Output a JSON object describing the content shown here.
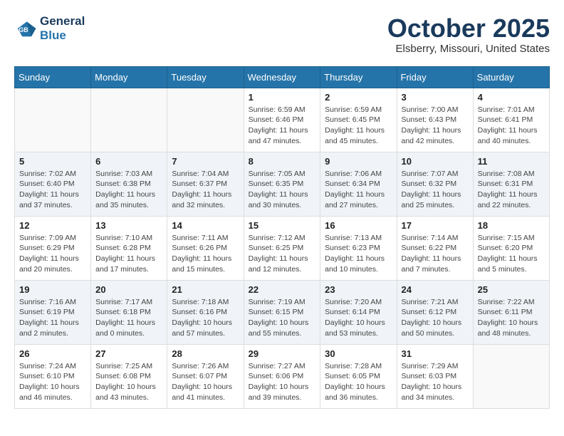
{
  "header": {
    "logo_line1": "General",
    "logo_line2": "Blue",
    "month_title": "October 2025",
    "location": "Elsberry, Missouri, United States"
  },
  "weekdays": [
    "Sunday",
    "Monday",
    "Tuesday",
    "Wednesday",
    "Thursday",
    "Friday",
    "Saturday"
  ],
  "weeks": [
    [
      {
        "day": "",
        "info": ""
      },
      {
        "day": "",
        "info": ""
      },
      {
        "day": "",
        "info": ""
      },
      {
        "day": "1",
        "info": "Sunrise: 6:59 AM\nSunset: 6:46 PM\nDaylight: 11 hours\nand 47 minutes."
      },
      {
        "day": "2",
        "info": "Sunrise: 6:59 AM\nSunset: 6:45 PM\nDaylight: 11 hours\nand 45 minutes."
      },
      {
        "day": "3",
        "info": "Sunrise: 7:00 AM\nSunset: 6:43 PM\nDaylight: 11 hours\nand 42 minutes."
      },
      {
        "day": "4",
        "info": "Sunrise: 7:01 AM\nSunset: 6:41 PM\nDaylight: 11 hours\nand 40 minutes."
      }
    ],
    [
      {
        "day": "5",
        "info": "Sunrise: 7:02 AM\nSunset: 6:40 PM\nDaylight: 11 hours\nand 37 minutes."
      },
      {
        "day": "6",
        "info": "Sunrise: 7:03 AM\nSunset: 6:38 PM\nDaylight: 11 hours\nand 35 minutes."
      },
      {
        "day": "7",
        "info": "Sunrise: 7:04 AM\nSunset: 6:37 PM\nDaylight: 11 hours\nand 32 minutes."
      },
      {
        "day": "8",
        "info": "Sunrise: 7:05 AM\nSunset: 6:35 PM\nDaylight: 11 hours\nand 30 minutes."
      },
      {
        "day": "9",
        "info": "Sunrise: 7:06 AM\nSunset: 6:34 PM\nDaylight: 11 hours\nand 27 minutes."
      },
      {
        "day": "10",
        "info": "Sunrise: 7:07 AM\nSunset: 6:32 PM\nDaylight: 11 hours\nand 25 minutes."
      },
      {
        "day": "11",
        "info": "Sunrise: 7:08 AM\nSunset: 6:31 PM\nDaylight: 11 hours\nand 22 minutes."
      }
    ],
    [
      {
        "day": "12",
        "info": "Sunrise: 7:09 AM\nSunset: 6:29 PM\nDaylight: 11 hours\nand 20 minutes."
      },
      {
        "day": "13",
        "info": "Sunrise: 7:10 AM\nSunset: 6:28 PM\nDaylight: 11 hours\nand 17 minutes."
      },
      {
        "day": "14",
        "info": "Sunrise: 7:11 AM\nSunset: 6:26 PM\nDaylight: 11 hours\nand 15 minutes."
      },
      {
        "day": "15",
        "info": "Sunrise: 7:12 AM\nSunset: 6:25 PM\nDaylight: 11 hours\nand 12 minutes."
      },
      {
        "day": "16",
        "info": "Sunrise: 7:13 AM\nSunset: 6:23 PM\nDaylight: 11 hours\nand 10 minutes."
      },
      {
        "day": "17",
        "info": "Sunrise: 7:14 AM\nSunset: 6:22 PM\nDaylight: 11 hours\nand 7 minutes."
      },
      {
        "day": "18",
        "info": "Sunrise: 7:15 AM\nSunset: 6:20 PM\nDaylight: 11 hours\nand 5 minutes."
      }
    ],
    [
      {
        "day": "19",
        "info": "Sunrise: 7:16 AM\nSunset: 6:19 PM\nDaylight: 11 hours\nand 2 minutes."
      },
      {
        "day": "20",
        "info": "Sunrise: 7:17 AM\nSunset: 6:18 PM\nDaylight: 11 hours\nand 0 minutes."
      },
      {
        "day": "21",
        "info": "Sunrise: 7:18 AM\nSunset: 6:16 PM\nDaylight: 10 hours\nand 57 minutes."
      },
      {
        "day": "22",
        "info": "Sunrise: 7:19 AM\nSunset: 6:15 PM\nDaylight: 10 hours\nand 55 minutes."
      },
      {
        "day": "23",
        "info": "Sunrise: 7:20 AM\nSunset: 6:14 PM\nDaylight: 10 hours\nand 53 minutes."
      },
      {
        "day": "24",
        "info": "Sunrise: 7:21 AM\nSunset: 6:12 PM\nDaylight: 10 hours\nand 50 minutes."
      },
      {
        "day": "25",
        "info": "Sunrise: 7:22 AM\nSunset: 6:11 PM\nDaylight: 10 hours\nand 48 minutes."
      }
    ],
    [
      {
        "day": "26",
        "info": "Sunrise: 7:24 AM\nSunset: 6:10 PM\nDaylight: 10 hours\nand 46 minutes."
      },
      {
        "day": "27",
        "info": "Sunrise: 7:25 AM\nSunset: 6:08 PM\nDaylight: 10 hours\nand 43 minutes."
      },
      {
        "day": "28",
        "info": "Sunrise: 7:26 AM\nSunset: 6:07 PM\nDaylight: 10 hours\nand 41 minutes."
      },
      {
        "day": "29",
        "info": "Sunrise: 7:27 AM\nSunset: 6:06 PM\nDaylight: 10 hours\nand 39 minutes."
      },
      {
        "day": "30",
        "info": "Sunrise: 7:28 AM\nSunset: 6:05 PM\nDaylight: 10 hours\nand 36 minutes."
      },
      {
        "day": "31",
        "info": "Sunrise: 7:29 AM\nSunset: 6:03 PM\nDaylight: 10 hours\nand 34 minutes."
      },
      {
        "day": "",
        "info": ""
      }
    ]
  ]
}
